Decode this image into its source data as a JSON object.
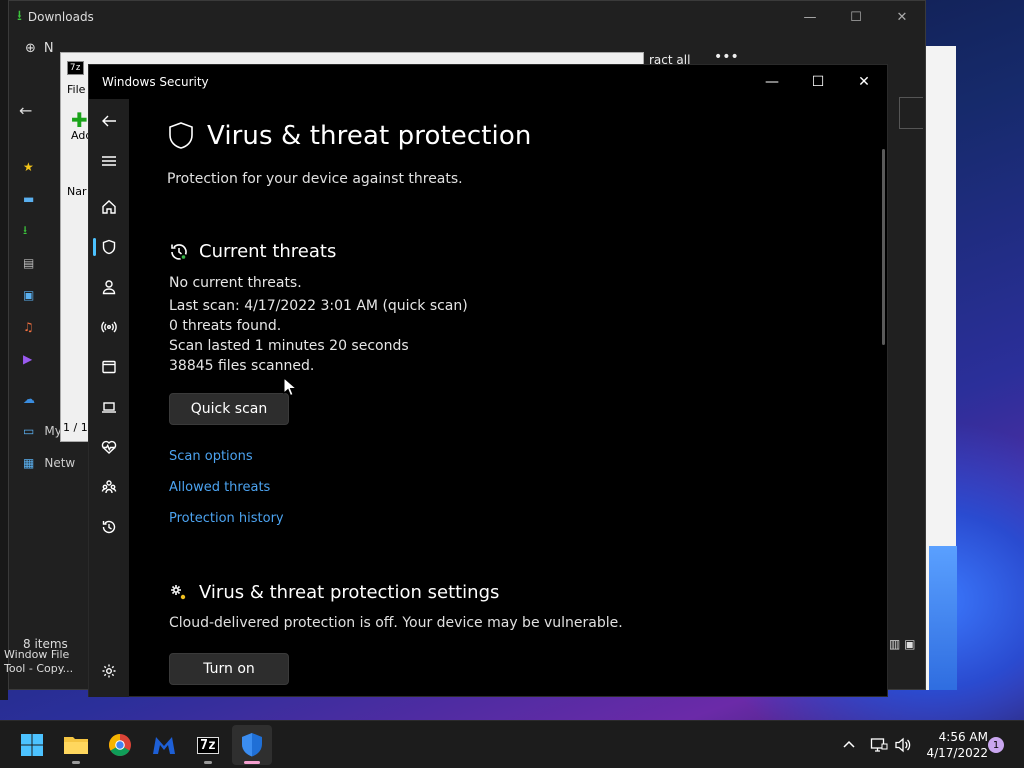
{
  "explorer": {
    "title": "Downloads",
    "cmd_new_label": "N",
    "extract_all_label": "ract all",
    "more_label": "•••",
    "status_items": "8 items",
    "status_extra": "1",
    "side_labels": [
      "My C",
      "Netw"
    ]
  },
  "sevenzip": {
    "logo": "7z",
    "menu_file": "File",
    "add_label": "Add",
    "col_name": "Nar",
    "status": "1 / 1"
  },
  "behind_text": {
    "line1": "Window File",
    "line2": "Tool - Copy..."
  },
  "security": {
    "window_title": "Windows Security",
    "page_title": "Virus & threat protection",
    "page_subtitle": "Protection for your device against threats.",
    "current_threats": {
      "title": "Current threats",
      "no_threats": "No current threats.",
      "last_scan": "Last scan: 4/17/2022 3:01 AM (quick scan)",
      "threats_found": "0 threats found.",
      "scan_duration": "Scan lasted 1 minutes 20 seconds",
      "files_scanned": "38845 files scanned.",
      "quick_scan_button": "Quick scan",
      "links": {
        "scan_options": "Scan options",
        "allowed_threats": "Allowed threats",
        "protection_history": "Protection history"
      }
    },
    "settings": {
      "title": "Virus & threat protection settings",
      "description": "Cloud-delivered protection is off. Your device may be vulnerable.",
      "turn_on_button": "Turn on"
    }
  },
  "taskbar": {
    "clock_time": "4:56 AM",
    "clock_date": "4/17/2022",
    "notification_count": "1",
    "sevenzip_label": "7z"
  },
  "colors": {
    "link": "#4ca3f0",
    "nav_accent": "#4cc2ff",
    "button_bg": "#2d2d2d",
    "window_bg": "#000000",
    "nav_bg": "#1f1f1f"
  }
}
